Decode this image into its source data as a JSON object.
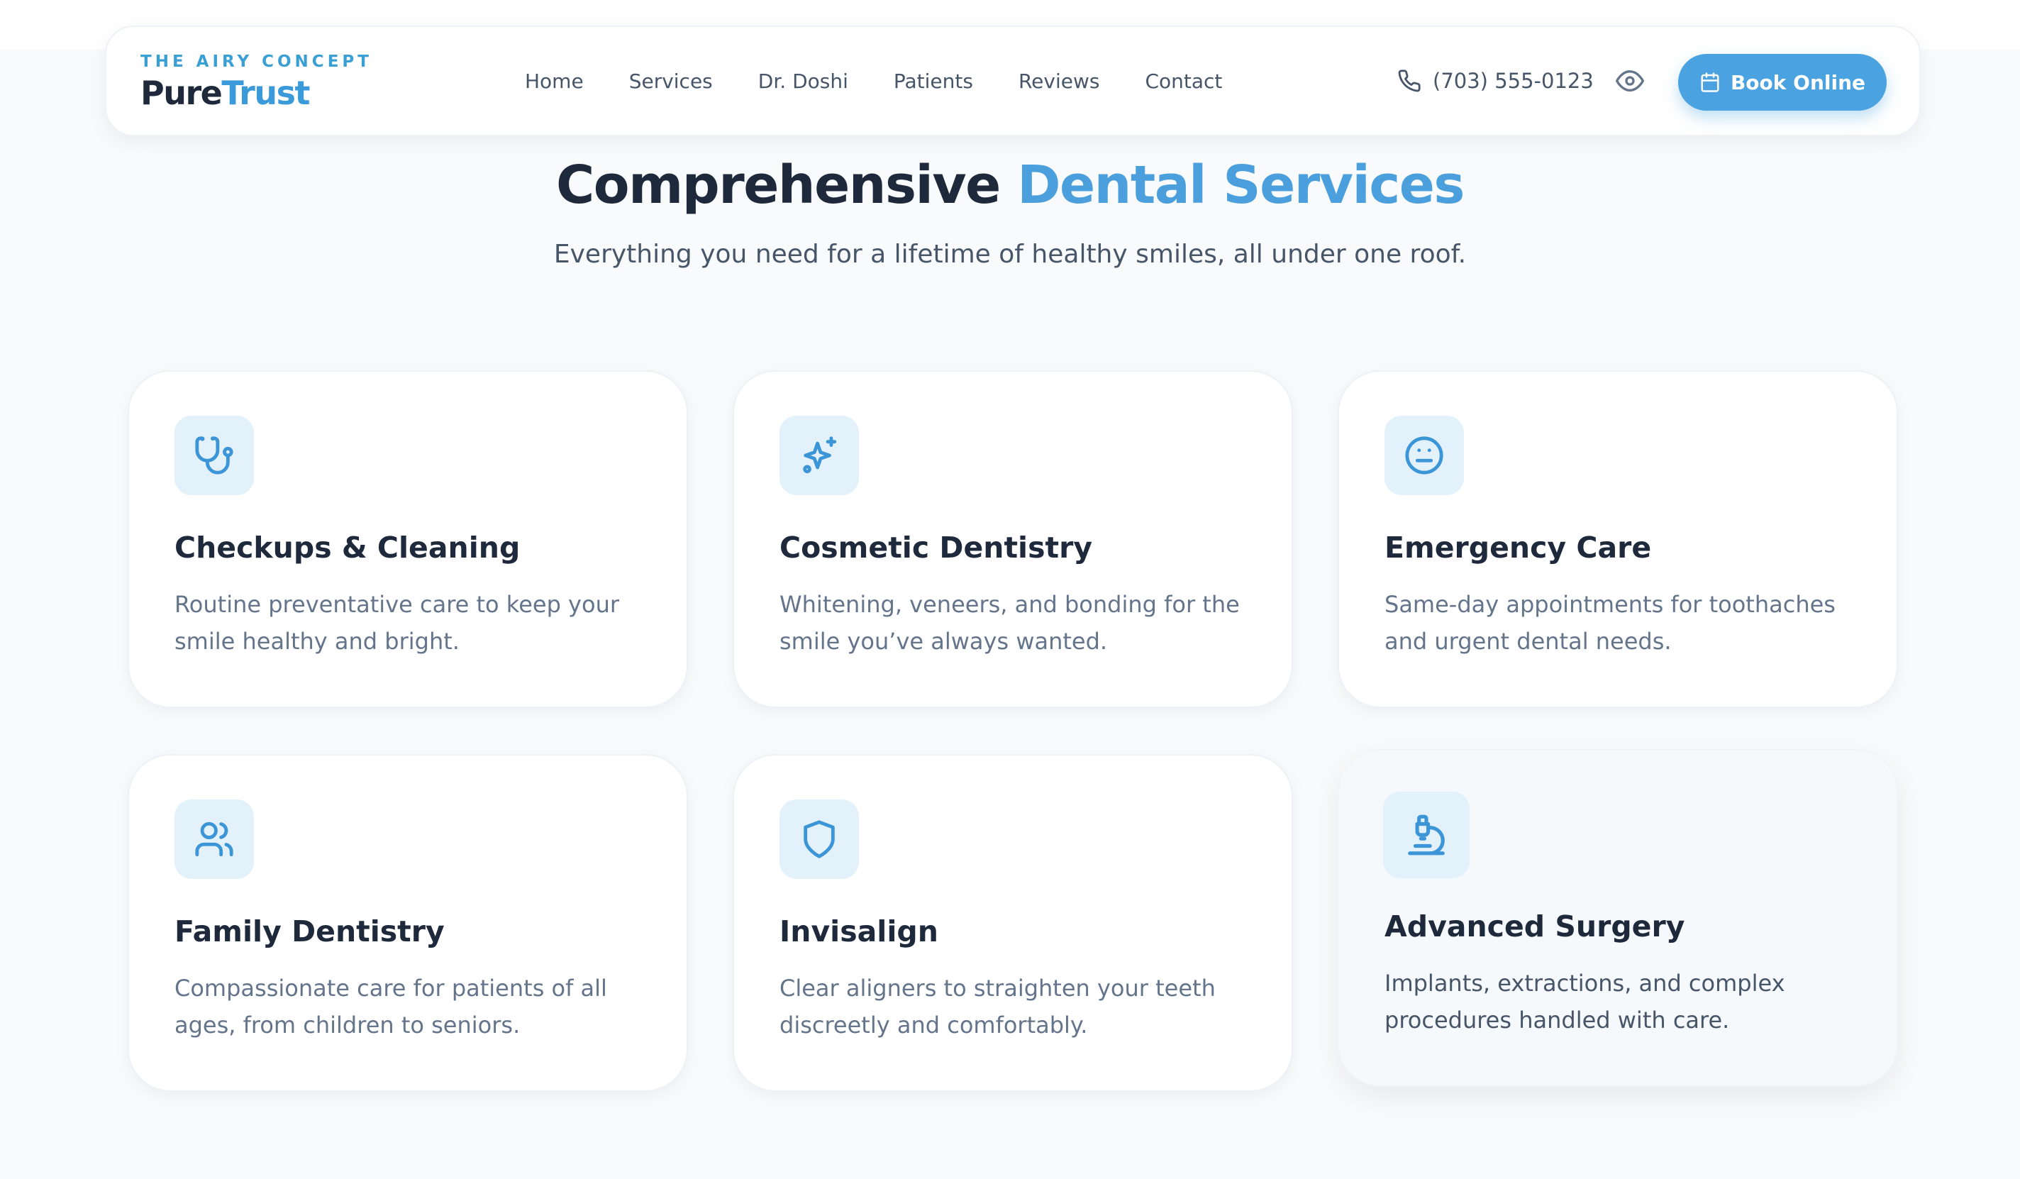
{
  "brand": {
    "tagline": "THE AIRY CONCEPT",
    "name_part1": "Pure",
    "name_part2": "Trust"
  },
  "nav": {
    "items": [
      {
        "label": "Home"
      },
      {
        "label": "Services"
      },
      {
        "label": "Dr. Doshi"
      },
      {
        "label": "Patients"
      },
      {
        "label": "Reviews"
      },
      {
        "label": "Contact"
      }
    ]
  },
  "header": {
    "phone": "(703) 555-0123",
    "phone_icon": "phone-icon",
    "accessibility_icon": "eye-icon",
    "book_label": "Book Online",
    "book_icon": "calendar-icon"
  },
  "hero": {
    "title_part1": "Comprehensive",
    "title_part2": "Dental Services",
    "subtitle": "Everything you need for a lifetime of healthy smiles, all under one roof."
  },
  "services": [
    {
      "icon": "stethoscope-icon",
      "title": "Checkups & Cleaning",
      "description": "Routine preventative care to keep your smile healthy and bright."
    },
    {
      "icon": "sparkles-icon",
      "title": "Cosmetic Dentistry",
      "description": "Whitening, veneers, and bonding for the smile you’ve always wanted."
    },
    {
      "icon": "meh-face-icon",
      "title": "Emergency Care",
      "description": "Same-day appointments for toothaches and urgent dental needs."
    },
    {
      "icon": "users-icon",
      "title": "Family Dentistry",
      "description": "Compassionate care for patients of all ages, from children to seniors."
    },
    {
      "icon": "shield-icon",
      "title": "Invisalign",
      "description": "Clear aligners to straighten your teeth discreetly and comfortably."
    },
    {
      "icon": "microscope-icon",
      "title": "Advanced Surgery",
      "description": "Implants, extractions, and complex procedures handled with care."
    }
  ],
  "colors": {
    "accent": "#4aa3e0",
    "text_dark": "#1e293b",
    "text_muted": "#64748b",
    "icon_bg": "#e3f1fb"
  }
}
